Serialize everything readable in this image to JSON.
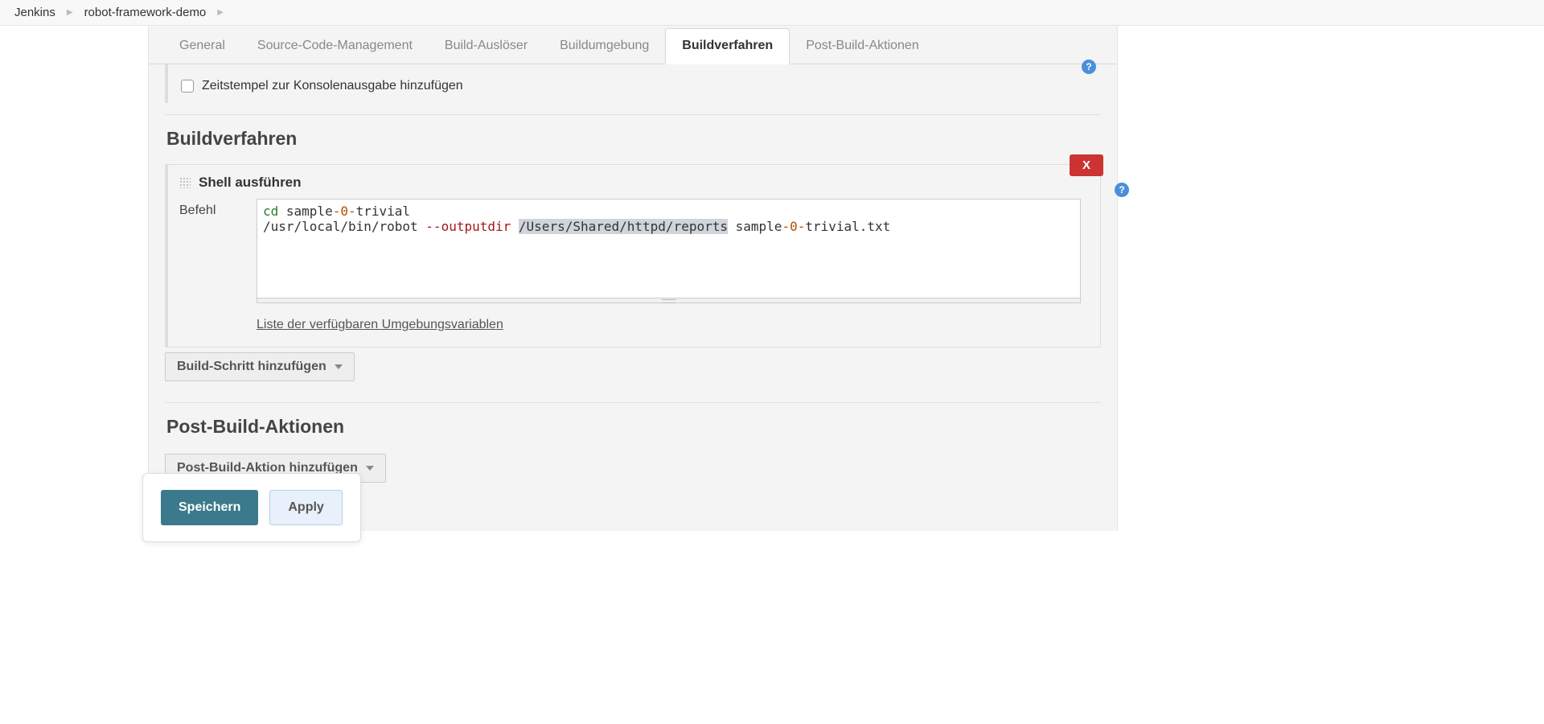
{
  "breadcrumb": {
    "root": "Jenkins",
    "job": "robot-framework-demo"
  },
  "tabs": {
    "general": "General",
    "scm": "Source-Code-Management",
    "triggers": "Build-Auslöser",
    "env": "Buildumgebung",
    "build": "Buildverfahren",
    "post": "Post-Build-Aktionen"
  },
  "env_section": {
    "timestamps_label": "Zeitstempel zur Konsolenausgabe hinzufügen"
  },
  "build_section": {
    "title": "Buildverfahren",
    "step_title": "Shell ausführen",
    "command_label": "Befehl",
    "delete_label": "X",
    "command_tokens": {
      "l1_cd": "cd",
      "l1_dir_a": " sample",
      "l1_dir_b": "-0-",
      "l1_dir_c": "trivial",
      "l2_bin": "/usr/local/bin/robot ",
      "l2_flag": "--outputdir",
      "l2_sp1": " ",
      "l2_path": "/Users/Shared/httpd/reports",
      "l2_sp2": " sample",
      "l2_num": "-0-",
      "l2_tail": "trivial.txt"
    },
    "command_plain": "cd sample-0-trivial\n/usr/local/bin/robot --outputdir /Users/Shared/httpd/reports sample-0-trivial.txt",
    "env_vars_link": "Liste der verfügbaren Umgebungsvariablen",
    "add_step": "Build-Schritt hinzufügen"
  },
  "post_section": {
    "title": "Post-Build-Aktionen",
    "add_action": "Post-Build-Aktion hinzufügen"
  },
  "actions": {
    "save": "Speichern",
    "apply": "Apply"
  },
  "help_glyph": "?"
}
